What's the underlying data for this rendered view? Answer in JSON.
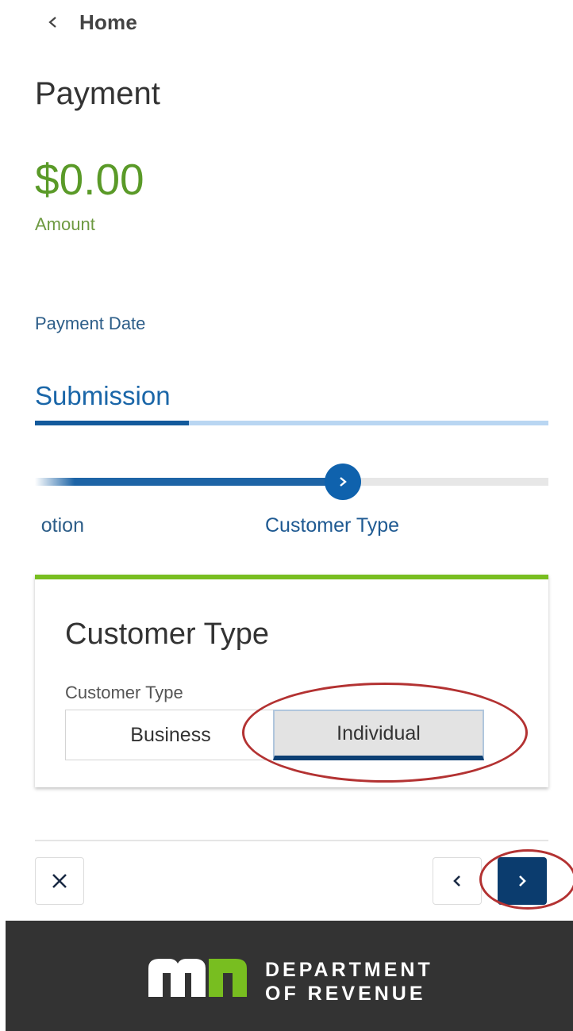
{
  "header": {
    "back_label": "Home"
  },
  "page": {
    "title": "Payment",
    "amount_value": "$0.00",
    "amount_label": "Amount",
    "payment_date_label": "Payment Date"
  },
  "section": {
    "title": "Submission",
    "progress": 0.3
  },
  "stepper": {
    "previous_label_partial": "otion",
    "current_label": "Customer Type"
  },
  "card": {
    "title": "Customer Type",
    "field_label": "Customer Type",
    "options": [
      {
        "label": "Business",
        "selected": false
      },
      {
        "label": "Individual",
        "selected": true
      }
    ]
  },
  "footer": {
    "line1": "DEPARTMENT",
    "line2": "OF REVENUE"
  },
  "icons": {
    "back": "chevron-left-icon",
    "step": "chevron-right-icon",
    "cancel": "close-icon",
    "prev": "chevron-left-icon",
    "next": "chevron-right-icon"
  },
  "colors": {
    "accent_green": "#5a9a28",
    "primary_blue": "#0f62ad",
    "dark_navy": "#0b3c6e",
    "annotation_red": "#b33232",
    "footer_bg": "#333333"
  }
}
